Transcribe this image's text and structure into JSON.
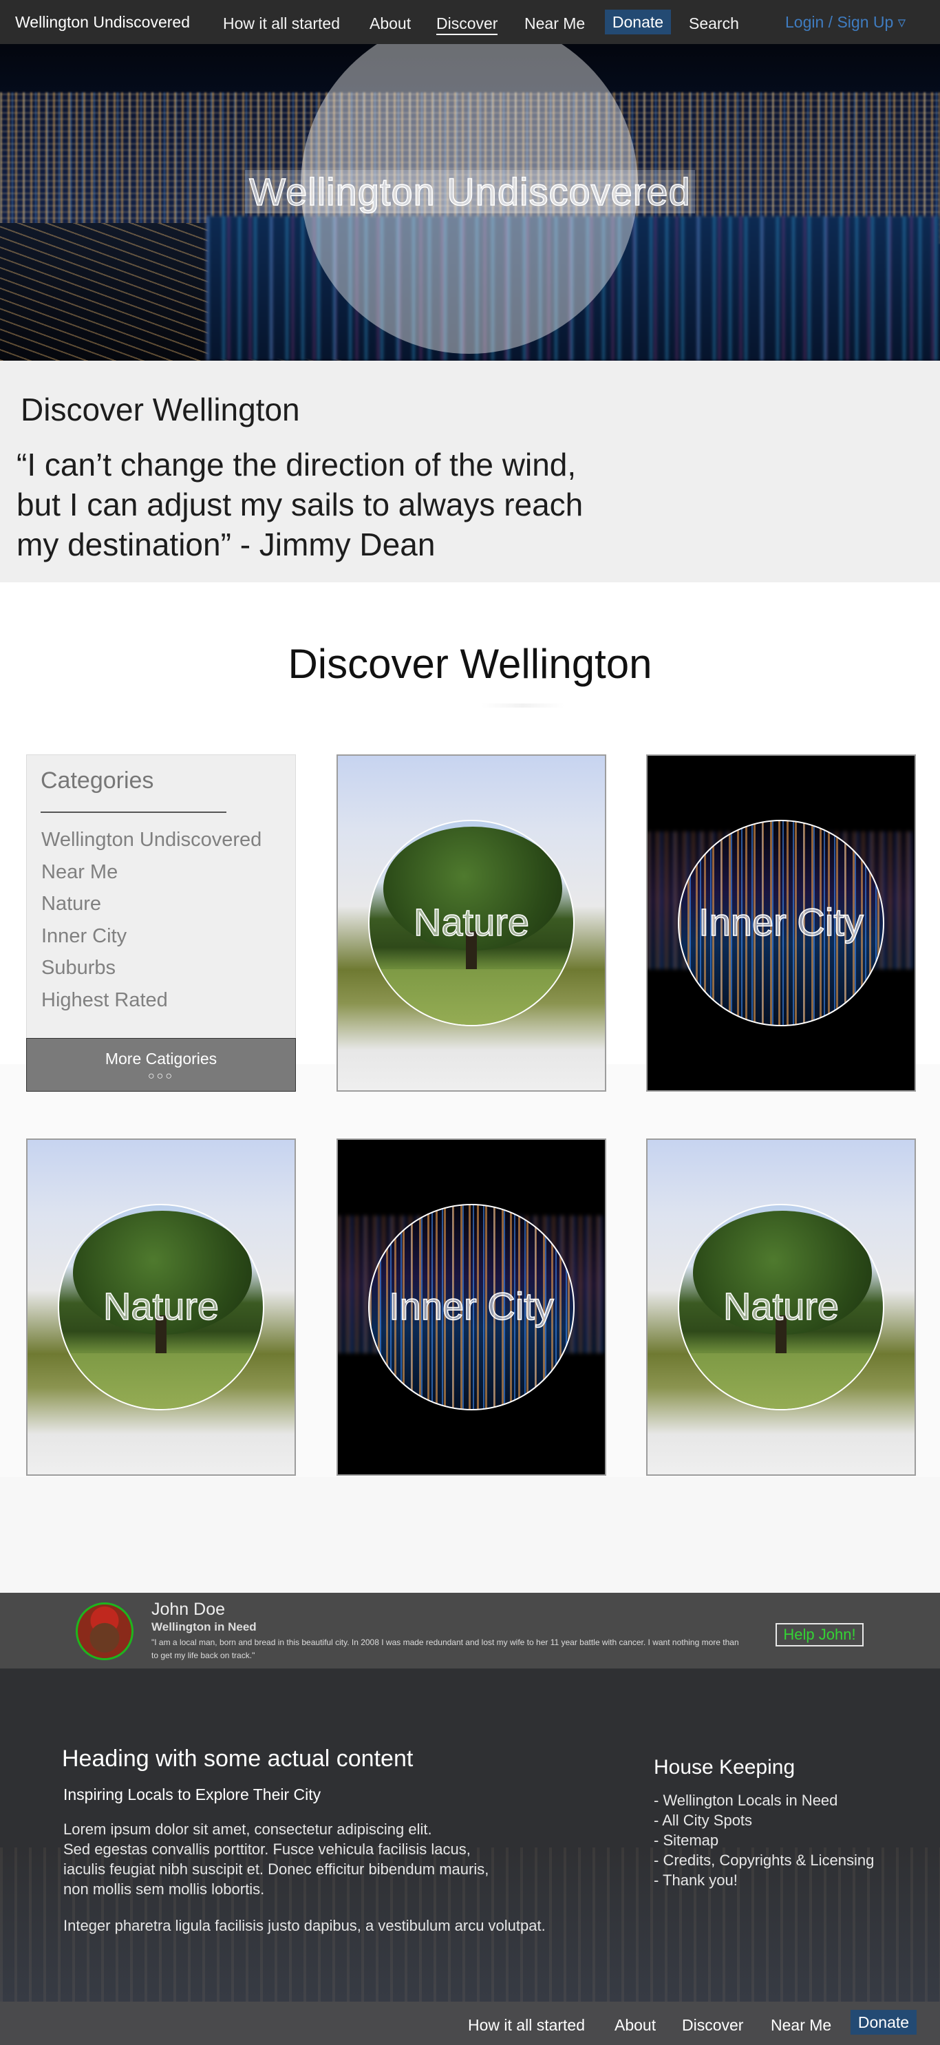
{
  "nav": {
    "brand": "Wellington Undiscovered",
    "links": [
      "How it all started",
      "About",
      "Discover",
      "Near Me"
    ],
    "donate": "Donate",
    "search": "Search",
    "login": "Login / Sign Up ▿"
  },
  "hero": {
    "title": "Wellington Undiscovered"
  },
  "intro": {
    "heading": "Discover Wellington",
    "quote": "“I can’t change the direction of the wind,\n but I can adjust my sails to always reach\n my destination” - Jimmy Dean"
  },
  "discover": {
    "title": "Discover Wellington",
    "categories": {
      "title": "Categories",
      "items": [
        "Wellington Undiscovered",
        "Near Me",
        "Nature",
        "Inner City",
        "Suburbs",
        "Highest Rated"
      ],
      "more_label": "More Catigories",
      "more_dots": "○○○"
    },
    "cards": [
      {
        "label": "Nature"
      },
      {
        "label": "Inner City"
      },
      {
        "label": "Nature"
      },
      {
        "label": "Inner City"
      },
      {
        "label": "Nature"
      }
    ]
  },
  "testimonial": {
    "name": "John Doe",
    "role": "Wellington in Need",
    "story": "\"I am a local man, born and bread in this beautiful city. In 2008 I was made redundant and lost my wife to her 11 year battle with cancer. I want nothing more than to get my life back on track.\"",
    "button": "Help John!"
  },
  "footer": {
    "heading": "Heading with some actual content",
    "subheading": "Inspiring Locals to Explore Their City",
    "body": "Lorem ipsum dolor sit amet, consectetur adipiscing elit.\nSed egestas convallis porttitor. Fusce vehicula facilisis lacus,\niaculis feugiat nibh suscipit et. Donec efficitur bibendum mauris,\nnon mollis sem mollis lobortis.",
    "body2": "Integer pharetra ligula facilisis justo dapibus, a vestibulum arcu volutpat.",
    "housekeeping_title": "House Keeping",
    "housekeeping_items": [
      "- Wellington Locals in Need",
      "- All City Spots",
      "- Sitemap",
      "- Credits, Copyrights & Licensing",
      "- Thank you!"
    ]
  },
  "bottom_nav": {
    "links": [
      "How it all started",
      "About",
      "Discover",
      "Near Me"
    ],
    "donate": "Donate"
  },
  "colors": {
    "nav_bg": "#2c2c2c",
    "donate_bg": "#234a73",
    "login_link": "#3f7cc0",
    "help_button_text": "#34d434"
  }
}
